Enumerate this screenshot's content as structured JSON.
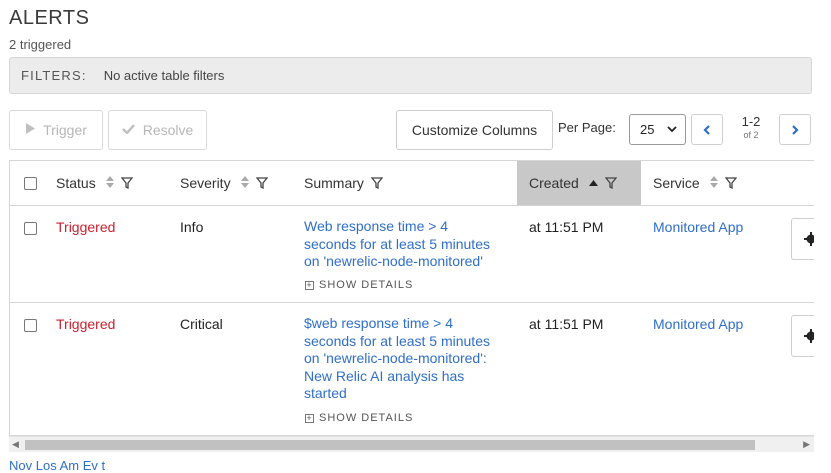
{
  "page": {
    "title": "ALERTS",
    "subtitle": "2 triggered"
  },
  "filters": {
    "label": "FILTERS:",
    "value": "No active table filters"
  },
  "toolbar": {
    "trigger_label": "Trigger",
    "resolve_label": "Resolve",
    "customize_label": "Customize Columns",
    "per_page_label": "Per Page:",
    "per_page_value": "25",
    "page_range": "1-2",
    "page_total": "of 2"
  },
  "table": {
    "columns": [
      {
        "label": "Status",
        "sortable": true,
        "filter": true
      },
      {
        "label": "Severity",
        "sortable": true,
        "filter": true
      },
      {
        "label": "Summary",
        "sortable": false,
        "filter": true
      },
      {
        "label": "Created",
        "sortable": true,
        "sorted": "asc",
        "filter": true
      },
      {
        "label": "Service",
        "sortable": true,
        "filter": true
      }
    ],
    "rows": [
      {
        "status": "Triggered",
        "severity": "Info",
        "summary_lines": [
          "Web response time > 4",
          "seconds for at least 5 minutes",
          "on 'newrelic-node-monitored'"
        ],
        "show_details": "SHOW DETAILS",
        "created": "at 11:51 PM",
        "service": "Monitored App"
      },
      {
        "status": "Triggered",
        "severity": "Critical",
        "summary_lines": [
          "$web response time > 4",
          "seconds for at least 5 minutes",
          "on 'newrelic-node-monitored':",
          "New Relic AI analysis has",
          "started"
        ],
        "show_details": "SHOW DETAILS",
        "created": "at 11:51 PM",
        "service": "Monitored App"
      }
    ]
  },
  "footer": {
    "partial_text": "Nov  Los Am  Ev  t"
  },
  "colors": {
    "status_red": "#c8202f",
    "link_blue": "#2f6fc9",
    "sorted_header": "#c8c8c8"
  }
}
